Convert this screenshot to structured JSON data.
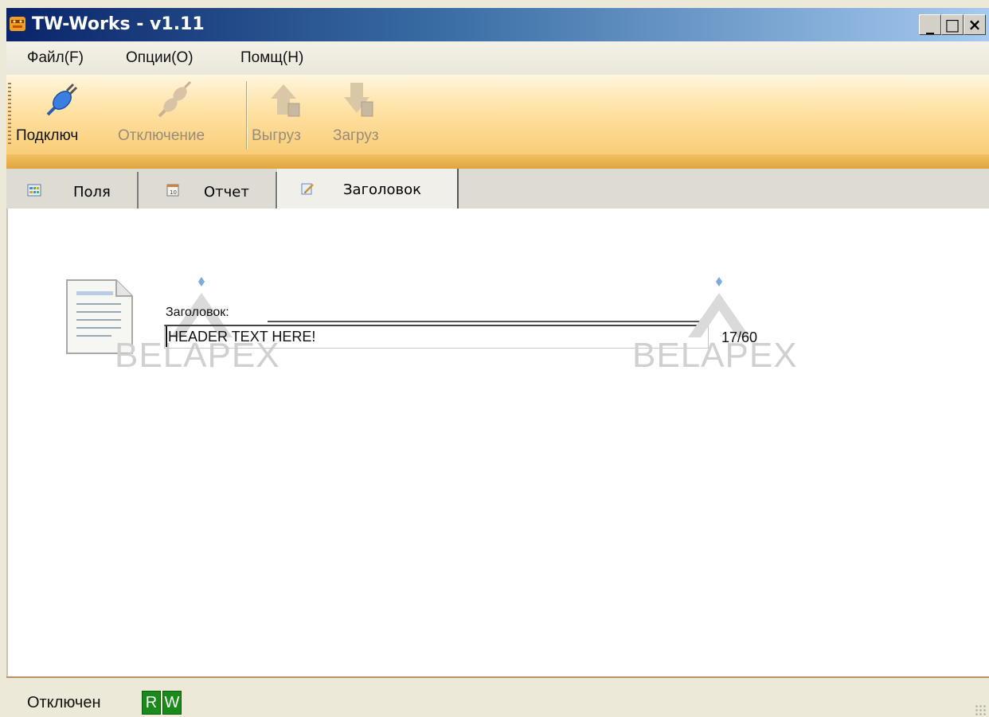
{
  "window": {
    "title": "TW-Works - v1.11",
    "controls": {
      "minimize": "_",
      "maximize": "□",
      "close": "×"
    }
  },
  "menu": {
    "items": [
      {
        "label": "Файл(F)"
      },
      {
        "label": "Опции(O)"
      },
      {
        "label": "Помщ(H)"
      }
    ]
  },
  "toolbar": {
    "buttons": [
      {
        "label": "Подключ",
        "icon": "plug-connect-icon",
        "enabled": true
      },
      {
        "label": "Отключение",
        "icon": "plug-disconnect-icon",
        "enabled": false
      },
      {
        "label": "Выгруз",
        "icon": "upload-arrow-icon",
        "enabled": false
      },
      {
        "label": "Загруз",
        "icon": "download-arrow-icon",
        "enabled": false
      }
    ]
  },
  "tabs": {
    "items": [
      {
        "label": "Поля",
        "icon": "fields-grid-icon",
        "active": false
      },
      {
        "label": "Отчет",
        "icon": "report-calendar-icon",
        "active": false
      },
      {
        "label": "Заголовок",
        "icon": "pencil-note-icon",
        "active": true
      }
    ]
  },
  "header_panel": {
    "icon": "document-icon",
    "label": "Заголовок:",
    "value": "HEADER TEXT HERE!",
    "counter": "17/60"
  },
  "watermark": {
    "text": "BELAPEX"
  },
  "status": {
    "connection": "Отключен",
    "flags": [
      "R",
      "W"
    ],
    "flag_color": "#1a8a1a"
  },
  "colors": {
    "titlebar_start": "#0a246a",
    "titlebar_end": "#a6caf0",
    "toolbar_accent": "#f9cd77",
    "band": "#e0a540"
  }
}
